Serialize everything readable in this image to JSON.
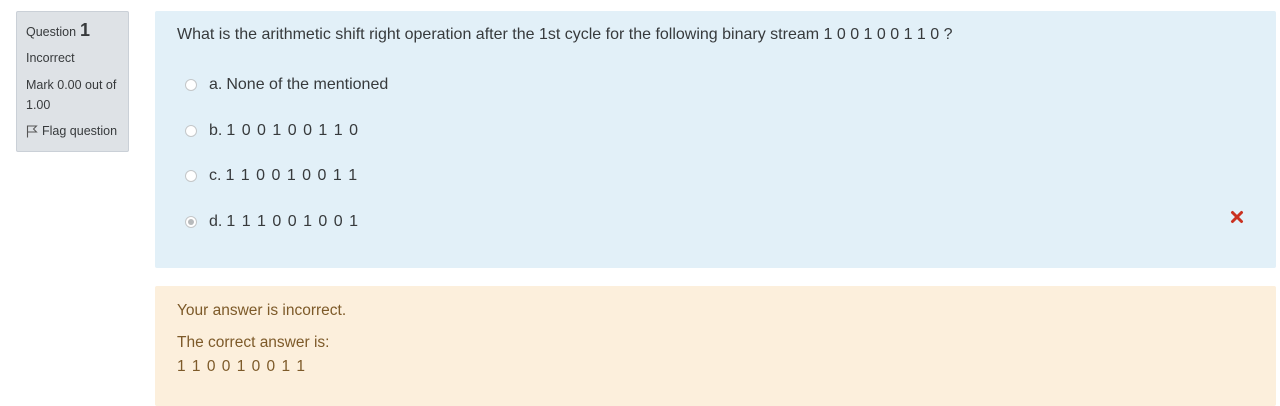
{
  "info": {
    "question_label": "Question",
    "question_number": "1",
    "state": "Incorrect",
    "grade": "Mark 0.00 out of 1.00",
    "flag_label": "Flag question"
  },
  "question": {
    "text": "What is the arithmetic shift right operation after the 1st cycle for the following binary stream 1 0 0 1 0 0 1 1 0 ?",
    "options": [
      {
        "letter": "a.",
        "text": "None of the mentioned",
        "selected": false
      },
      {
        "letter": "b.",
        "text": "1 0 0 1 0 0 1 1 0",
        "selected": false
      },
      {
        "letter": "c.",
        "text": "1 1 0 0 1 0 0 1 1",
        "selected": false
      },
      {
        "letter": "d.",
        "text": "1 1 1 0 0 1 0 0 1",
        "selected": true
      }
    ],
    "result_icon": "incorrect-cross-icon",
    "result_color": "#ca3120"
  },
  "outcome": {
    "feedback": "Your answer is incorrect.",
    "right_answer_label": "The correct answer is:",
    "right_answer_value": "1 1 0 0 1 0 0 1 1"
  }
}
